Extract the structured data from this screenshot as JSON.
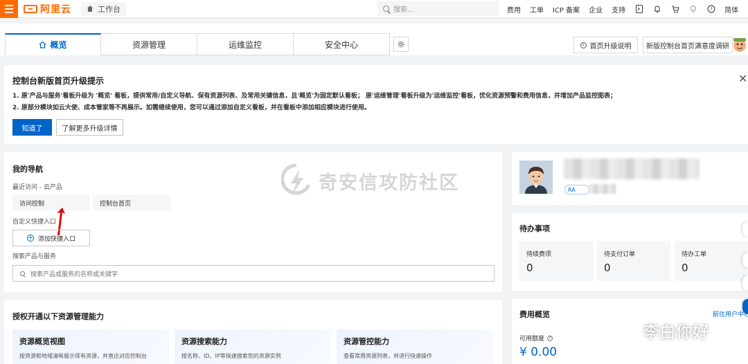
{
  "topbar": {
    "brand": "阿里云",
    "workbench": "工作台",
    "search_placeholder": "搜索...",
    "nav": [
      "费用",
      "工单",
      "ICP 备案",
      "企业",
      "支持"
    ],
    "lang": "简体",
    "accent": "#ff6a00"
  },
  "tabs": {
    "items": [
      "概览",
      "资源管理",
      "运维监控",
      "安全中心"
    ],
    "upgrade_info": "首页升级说明",
    "survey": "新版控制台首页满意度调研"
  },
  "banner": {
    "title": "控制台新版首页升级提示",
    "line1": "1. 原'产品与服务'看板升级为 '概览' 看板，提供常用/自定义导航、保有资源列表、及常用关键信息，且'概览'为固定默认看板；  原'运维管理'看板升级为'运维监控'看板，优化资源预警和费用信息，并增加产品监控图表；",
    "line2": "2. 原部分模块如云大使、成本管家等不再展示。如需继续使用，您可以通过添加自定义看板，并在看板中添加相应模块进行使用。",
    "ok_button": "知道了",
    "more_button": "了解更多升级详情"
  },
  "my_nav": {
    "title": "我的导航",
    "recent_label": "最近访问 - 云产品",
    "recent_items": [
      "访问控制",
      "控制台首页"
    ],
    "custom_label": "自定义快捷入口",
    "add_button": "添加快捷入口",
    "search_label": "搜索产品与服务",
    "search_placeholder": "搜索产品或服务的名称或关键字",
    "watermark": "奇安信攻防社区"
  },
  "auth": {
    "title": "授权开通以下资源管理能力",
    "cards": [
      {
        "title": "资源概览视图",
        "desc": "按资源和地域清晰展示保有资源，并直达对应控制台"
      },
      {
        "title": "资源搜索能力",
        "desc": "按名称、ID、IP等快速搜索您的资源实例"
      },
      {
        "title": "资源管控能力",
        "desc": "查看常用资源列表，并进行快速操作"
      }
    ]
  },
  "profile": {
    "badge": "RA"
  },
  "todo": {
    "title": "待办事项",
    "items": [
      {
        "label": "待续费项",
        "value": "0"
      },
      {
        "label": "待支付订单",
        "value": "0"
      },
      {
        "label": "待办工单",
        "value": "0"
      }
    ]
  },
  "fee": {
    "title": "费用概览",
    "link": "前往用户中心",
    "balance_label": "可用额度",
    "balance_value": "¥ 0.00"
  },
  "overlay": {
    "wechat": "李白你好"
  },
  "colors": {
    "primary": "#0064c8",
    "brand": "#ff6a00"
  }
}
